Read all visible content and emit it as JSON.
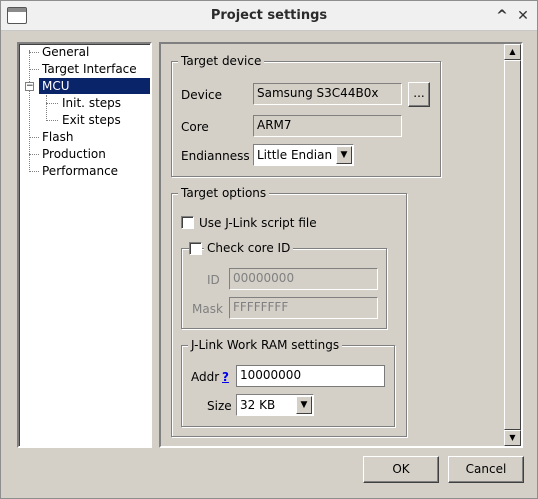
{
  "window": {
    "title": "Project settings",
    "minimize_glyph": "^",
    "close_glyph": "✕"
  },
  "tree": {
    "items": [
      {
        "label": "General"
      },
      {
        "label": "Target Interface"
      },
      {
        "label": "MCU",
        "selected": true,
        "expanded": true
      },
      {
        "label": "Init. steps"
      },
      {
        "label": "Exit steps"
      },
      {
        "label": "Flash"
      },
      {
        "label": "Production"
      },
      {
        "label": "Performance"
      }
    ],
    "expander_glyph": "−"
  },
  "target_device": {
    "group_label": "Target device",
    "device_label": "Device",
    "device_value": "Samsung S3C44B0x",
    "browse_label": "...",
    "core_label": "Core",
    "core_value": "ARM7",
    "endianness_label": "Endianness",
    "endianness_value": "Little Endian"
  },
  "target_options": {
    "group_label": "Target options",
    "use_script_label": "Use J-Link script file",
    "check_core_id_label": "Check core ID",
    "id_label": "ID",
    "id_value": "00000000",
    "mask_label": "Mask",
    "mask_value": "FFFFFFFF",
    "work_ram": {
      "group_label": "J-Link Work RAM settings",
      "addr_label": "Addr",
      "help_label": "?",
      "addr_value": "10000000",
      "size_label": "Size",
      "size_value": "32 KB"
    }
  },
  "buttons": {
    "ok": "OK",
    "cancel": "Cancel"
  },
  "icons": {
    "dropdown": "▼",
    "scroll_up": "▲",
    "scroll_down": "▼"
  }
}
